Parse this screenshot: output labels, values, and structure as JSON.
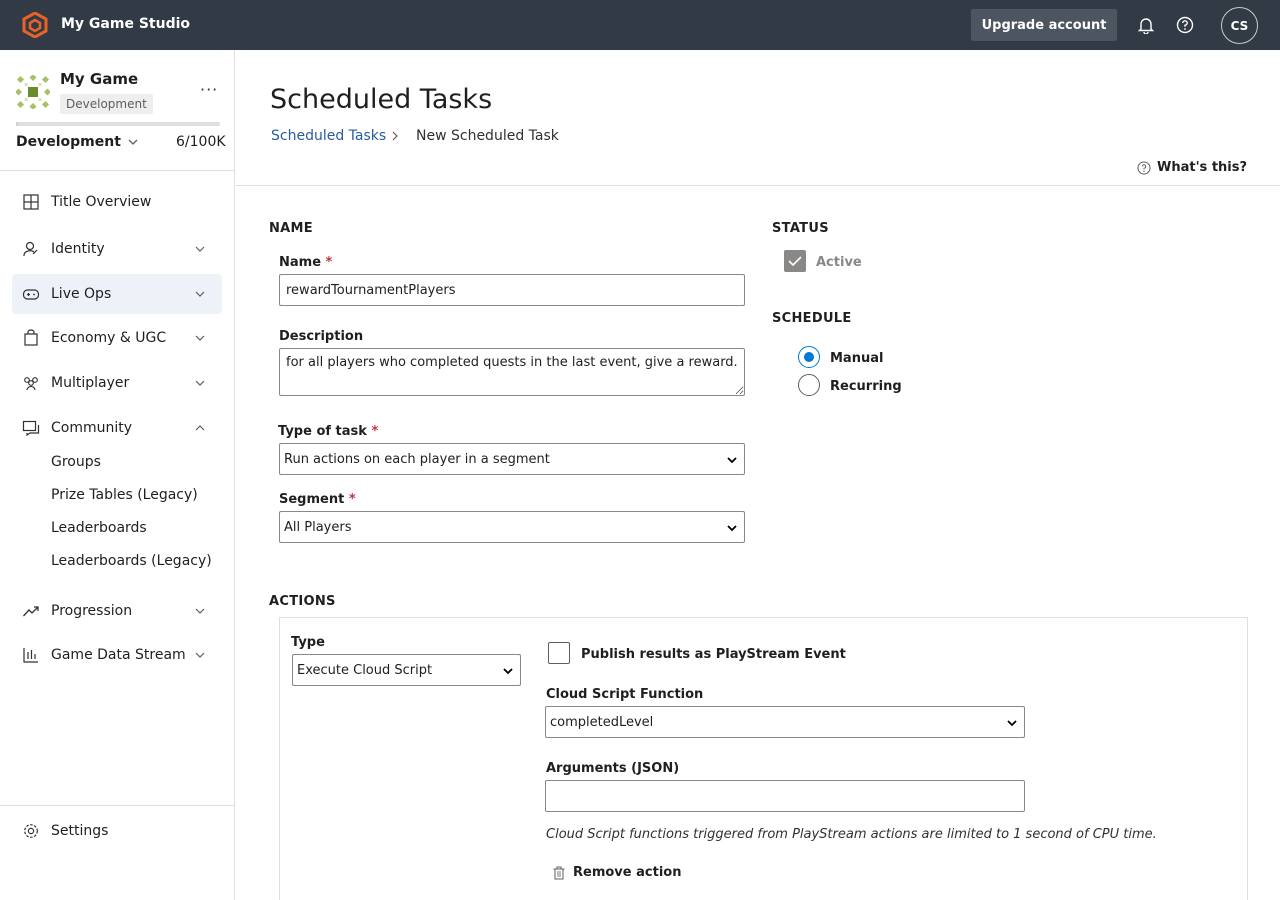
{
  "topbar": {
    "studio_name": "My Game Studio",
    "upgrade_label": "Upgrade account",
    "avatar_initials": "CS",
    "accent_color": "#e8622a"
  },
  "sidebar": {
    "game_name": "My Game",
    "env_badge": "Development",
    "env_select": "Development",
    "quota": "6/100K",
    "usage_fraction": 6e-05,
    "items": [
      {
        "label": "Title Overview",
        "icon": "grid-icon"
      },
      {
        "label": "Identity",
        "icon": "identity-icon"
      },
      {
        "label": "Live Ops",
        "icon": "gamepad-icon"
      },
      {
        "label": "Economy & UGC",
        "icon": "bag-icon"
      },
      {
        "label": "Multiplayer",
        "icon": "people-icon"
      },
      {
        "label": "Community",
        "icon": "chat-icon"
      },
      {
        "label": "Progression",
        "icon": "trend-icon"
      },
      {
        "label": "Game Data Stream",
        "icon": "bar-chart-icon"
      }
    ],
    "community_sub": [
      "Groups",
      "Prize Tables (Legacy)",
      "Leaderboards",
      "Leaderboards (Legacy)"
    ],
    "settings_label": "Settings"
  },
  "main": {
    "title": "Scheduled Tasks",
    "breadcrumb_link": "Scheduled Tasks",
    "breadcrumb_current": "New Scheduled Task",
    "whats_this": "What's this?",
    "name_section": "NAME",
    "name_label": "Name",
    "name_value": "rewardTournamentPlayers",
    "description_label": "Description",
    "description_value": "for all players who completed quests in the last event, give a reward.",
    "type_label": "Type of task",
    "type_value": "Run actions on each player in a segment",
    "segment_label": "Segment",
    "segment_value": "All Players",
    "status_section": "STATUS",
    "status_active": "Active",
    "schedule_section": "SCHEDULE",
    "schedule_manual": "Manual",
    "schedule_recurring": "Recurring",
    "actions_section": "ACTIONS",
    "action_type_label": "Type",
    "action_type_value": "Execute Cloud Script",
    "publish_label": "Publish results as PlayStream Event",
    "cloud_fn_label": "Cloud Script Function",
    "cloud_fn_value": "completedLevel",
    "args_label": "Arguments (JSON)",
    "args_value": "",
    "note": "Cloud Script functions triggered from PlayStream actions are limited to 1 second of CPU time.",
    "remove_action": "Remove action"
  }
}
